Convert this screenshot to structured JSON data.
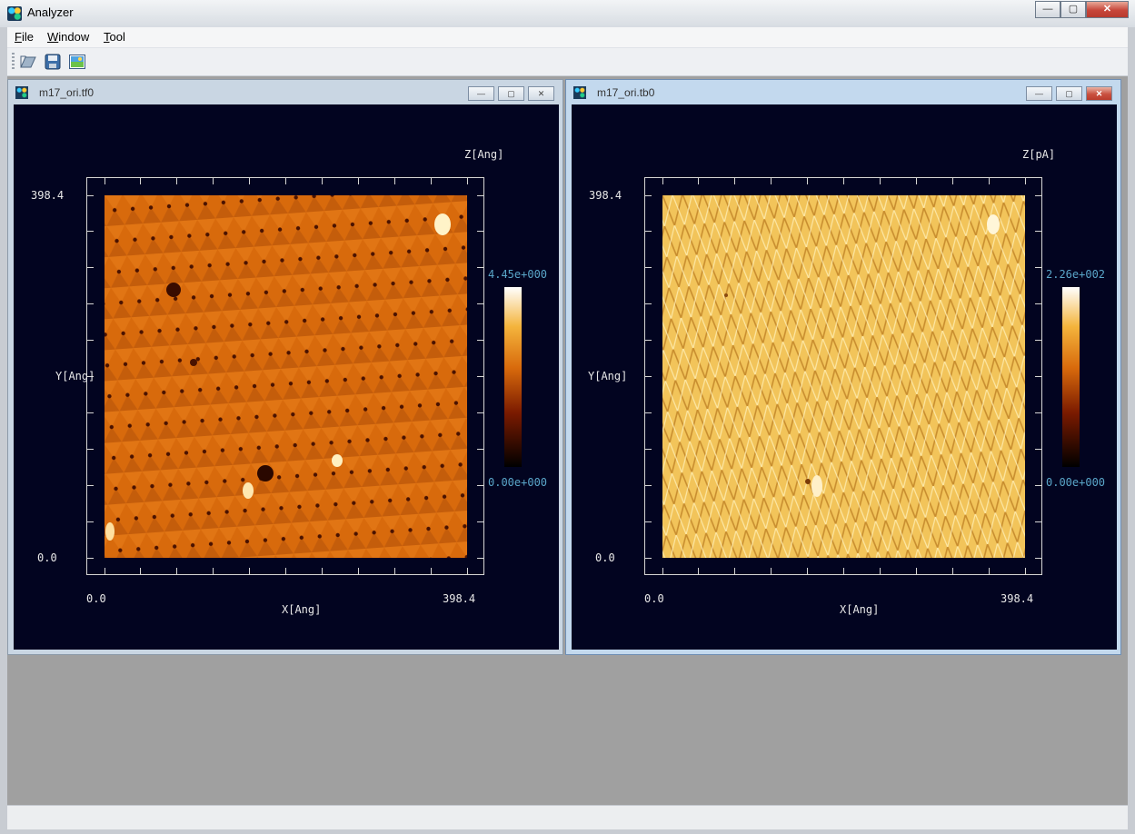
{
  "app": {
    "title": "Analyzer"
  },
  "window_controls": {
    "minimize": "—",
    "restore": "▢",
    "close": "✕"
  },
  "menu": [
    {
      "label": "File",
      "mnemonic": "F",
      "rest": "ile"
    },
    {
      "label": "Window",
      "mnemonic": "W",
      "rest": "indow"
    },
    {
      "label": "Tool",
      "mnemonic": "T",
      "rest": "ool"
    }
  ],
  "toolbar": {
    "icons": [
      "open-icon",
      "save-icon",
      "image-icon"
    ]
  },
  "windows": [
    {
      "title": "m17_ori.tf0",
      "z_label": "Z[Ang]",
      "y_label": "Y[Ang]",
      "x_label": "X[Ang]",
      "y_max": "398.4",
      "y_min": "0.0",
      "x_min": "0.0",
      "x_max": "398.4",
      "cbar_max": "4.45e+000",
      "cbar_min": "0.00e+000",
      "colormap": "afmhot",
      "image_tone": "#d86a0c"
    },
    {
      "title": "m17_ori.tb0",
      "z_label": "Z[pA]",
      "y_label": "Y[Ang]",
      "x_label": "X[Ang]",
      "y_max": "398.4",
      "y_min": "0.0",
      "x_min": "0.0",
      "x_max": "398.4",
      "cbar_max": "2.26e+002",
      "cbar_min": "0.00e+000",
      "colormap": "afmhot",
      "image_tone": "#f2c45a"
    }
  ]
}
